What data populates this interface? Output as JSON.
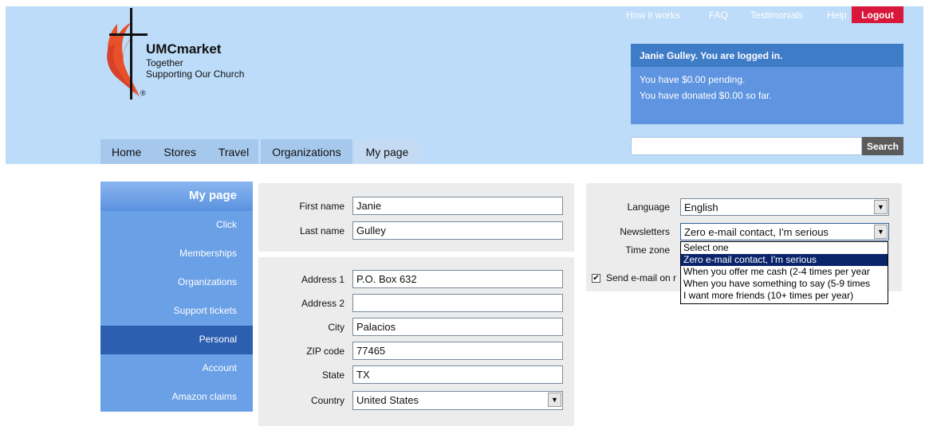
{
  "brand": {
    "name": "UMCmarket",
    "tagline_1": "Together",
    "tagline_2": "Supporting Our Church",
    "registered": "®"
  },
  "topnav": {
    "items": [
      "How it works",
      "FAQ",
      "Testimonials",
      "Help"
    ],
    "logout_label": "Logout"
  },
  "login": {
    "heading": "Janie Gulley. You are logged in.",
    "pending": "You have $0.00 pending.",
    "donated": "You have donated $0.00 so far."
  },
  "search": {
    "value": "",
    "button_label": "Search"
  },
  "mainnav": {
    "tabs": [
      "Home",
      "Stores",
      "Travel",
      "Organizations",
      "My page"
    ]
  },
  "sidebar": {
    "heading": "My page",
    "items": [
      "Click",
      "Memberships",
      "Organizations",
      "Support tickets",
      "Personal",
      "Account",
      "Amazon claims"
    ],
    "active_item": "Personal"
  },
  "name_form": {
    "first_name_label": "First name",
    "first_name_value": "Janie",
    "last_name_label": "Last name",
    "last_name_value": "Gulley"
  },
  "address_form": {
    "address1_label": "Address 1",
    "address1_value": "P.O. Box 632",
    "address2_label": "Address 2",
    "address2_value": "",
    "city_label": "City",
    "city_value": "Palacios",
    "zip_label": "ZIP code",
    "zip_value": "77465",
    "state_label": "State",
    "state_value": "TX",
    "country_label": "Country",
    "country_value": "United States"
  },
  "prefs": {
    "language_label": "Language",
    "language_value": "English",
    "newsletters_label": "Newsletters",
    "newsletters_value": "Zero e-mail contact, I'm serious",
    "timezone_label": "Time zone",
    "send_email_label": "Send e-mail on r",
    "send_email_checked": true,
    "newsletter_options": [
      "Select one",
      "Zero e-mail contact, I'm serious",
      "When you offer me cash (2-4 times per year",
      "When you have something to say (5-9 times",
      "I want more friends (10+ times per year)"
    ],
    "newsletter_highlighted": "Zero e-mail contact, I'm serious"
  },
  "colors": {
    "header_bg": "#bcdcf9",
    "accent_blue": "#3f7cc7",
    "sidebar_active": "#2c5fb0",
    "logout_red": "#d8173a"
  }
}
